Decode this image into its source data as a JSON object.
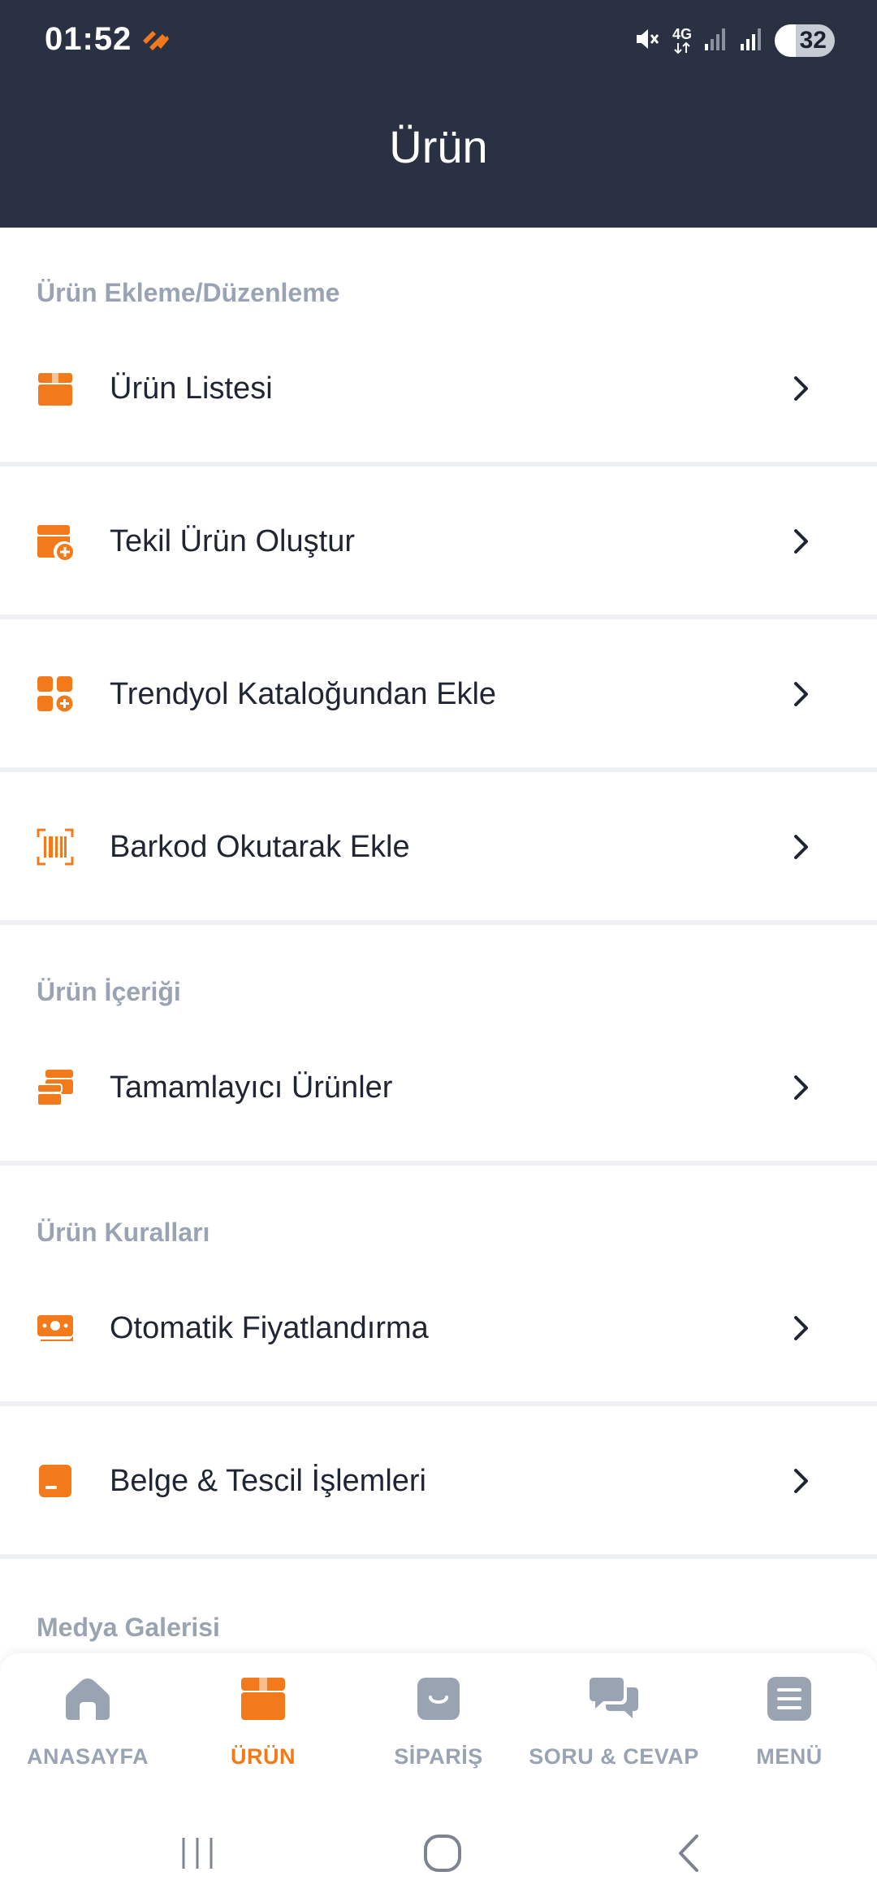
{
  "status_bar": {
    "time": "01:52",
    "network": "4G",
    "battery": "32"
  },
  "header": {
    "title": "Ürün"
  },
  "sections": [
    {
      "title": "Ürün Ekleme/Düzenleme",
      "items": [
        {
          "label": "Ürün Listesi",
          "icon": "box-icon"
        },
        {
          "label": "Tekil Ürün Oluştur",
          "icon": "box-plus-icon"
        },
        {
          "label": "Trendyol Kataloğundan Ekle",
          "icon": "grid-plus-icon"
        },
        {
          "label": "Barkod Okutarak Ekle",
          "icon": "barcode-icon"
        }
      ]
    },
    {
      "title": "Ürün İçeriği",
      "items": [
        {
          "label": "Tamamlayıcı Ürünler",
          "icon": "boxes-icon"
        }
      ]
    },
    {
      "title": "Ürün Kuralları",
      "items": [
        {
          "label": "Otomatik Fiyatlandırma",
          "icon": "money-icon"
        },
        {
          "label": "Belge & Tescil İşlemleri",
          "icon": "document-icon"
        }
      ]
    },
    {
      "title": "Medya Galerisi",
      "items": []
    }
  ],
  "bottom_nav": [
    {
      "label": "ANASAYFA",
      "icon": "home-icon",
      "active": false
    },
    {
      "label": "ÜRÜN",
      "icon": "box-icon",
      "active": true
    },
    {
      "label": "SİPARİŞ",
      "icon": "shopping-bag-icon",
      "active": false
    },
    {
      "label": "SORU & CEVAP",
      "icon": "chat-icon",
      "active": false
    },
    {
      "label": "MENÜ",
      "icon": "menu-icon",
      "active": false
    }
  ],
  "colors": {
    "header_bg": "#2a3142",
    "accent": "#f27a1a",
    "section_title": "#9aa3b2",
    "text": "#1f2533",
    "divider": "#eef0f4"
  }
}
